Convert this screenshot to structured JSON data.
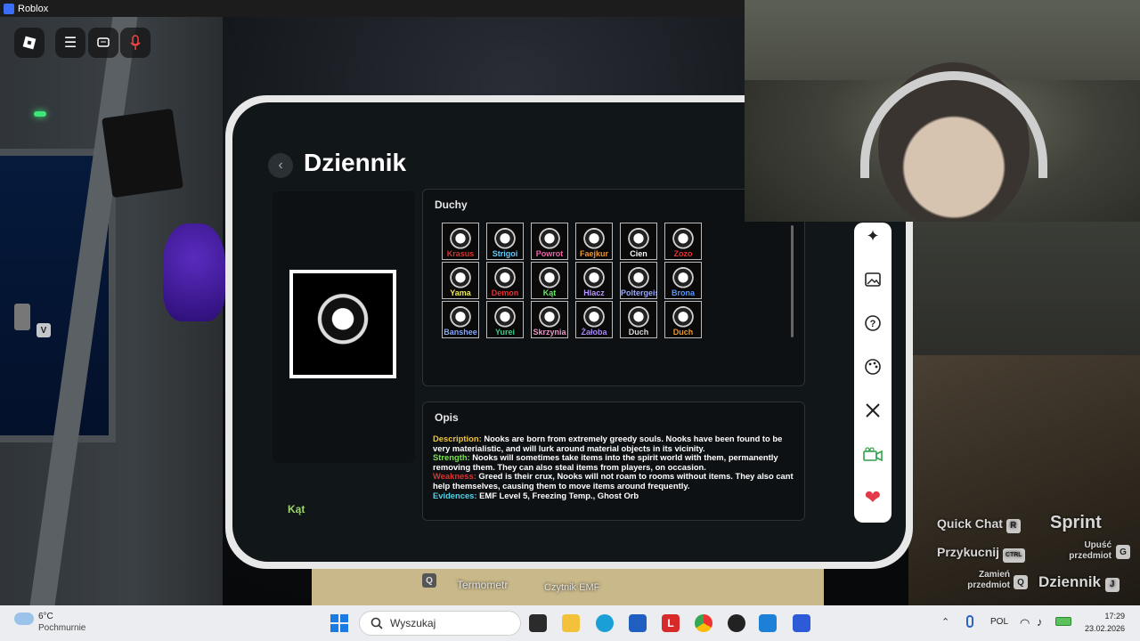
{
  "window": {
    "title": "Roblox"
  },
  "journal": {
    "title": "Dziennik",
    "ghosts_heading": "Duchy",
    "selected_ghost_category": "Kąt",
    "ghosts": [
      {
        "name": "Krasus",
        "color": "#d33"
      },
      {
        "name": "Strigoi",
        "color": "#6cf"
      },
      {
        "name": "Powrot",
        "color": "#e6a"
      },
      {
        "name": "Faejkur",
        "color": "#e93"
      },
      {
        "name": "Cien",
        "color": "#fff"
      },
      {
        "name": "Zozo",
        "color": "#e33"
      },
      {
        "name": "Yama",
        "color": "#ee5"
      },
      {
        "name": "Demon",
        "color": "#e33"
      },
      {
        "name": "Kąt",
        "color": "#6e6"
      },
      {
        "name": "Hlacz",
        "color": "#b9f"
      },
      {
        "name": "Poltergeist",
        "color": "#9af"
      },
      {
        "name": "Brona",
        "color": "#59f"
      },
      {
        "name": "Banshee",
        "color": "#8af"
      },
      {
        "name": "Yurei",
        "color": "#4c8"
      },
      {
        "name": "Skrzynia",
        "color": "#e9c"
      },
      {
        "name": "Żałoba",
        "color": "#a8f"
      },
      {
        "name": "Duch",
        "color": "#ddd"
      },
      {
        "name": "Duch",
        "color": "#e93"
      }
    ],
    "description": {
      "heading": "Opis",
      "description_label": "Description:",
      "description_text": "Nooks are born from extremely greedy souls. Nooks have been found to be very materialistic, and will lurk around material objects in its vicinity.",
      "strength_label": "Strength:",
      "strength_text": "Nooks will sometimes take items into the spirit world with them, permanently removing them. They can also steal items from players, on occasion.",
      "weakness_label": "Weakness:",
      "weakness_text": "Greed is their crux, Nooks will not roam to rooms without items. They also cant help themselves, causing them to move items around frequently.",
      "evidences_label": "Evidences:",
      "evidences_text": "EMF Level 5, Freezing Temp., Ghost Orb",
      "colors": {
        "description": "#f2c33a",
        "strength": "#7be04f",
        "weakness": "#e0322d",
        "evidences": "#4fd4e8"
      }
    }
  },
  "hud": {
    "quick_chat": "Quick Chat",
    "quick_chat_key": "R",
    "sprint": "Sprint",
    "crouch": "Przykucnij",
    "crouch_key": "CTRL",
    "drop_item": "Upuść przedmiot",
    "drop_key": "G",
    "swap_item": "Zamień przedmiot",
    "swap_key": "Q",
    "journal": "Dziennik",
    "journal_key": "J",
    "v_key": "V"
  },
  "hotbar": {
    "slot_key": "Q",
    "item1": "Termometr",
    "item2": "Czytnik EMF"
  },
  "taskbar": {
    "weather_temp": "6°C",
    "weather_desc": "Pochmurnie",
    "search_placeholder": "Wyszukaj",
    "lang": "POL",
    "time": "17:29",
    "date": "23.02.2026"
  }
}
